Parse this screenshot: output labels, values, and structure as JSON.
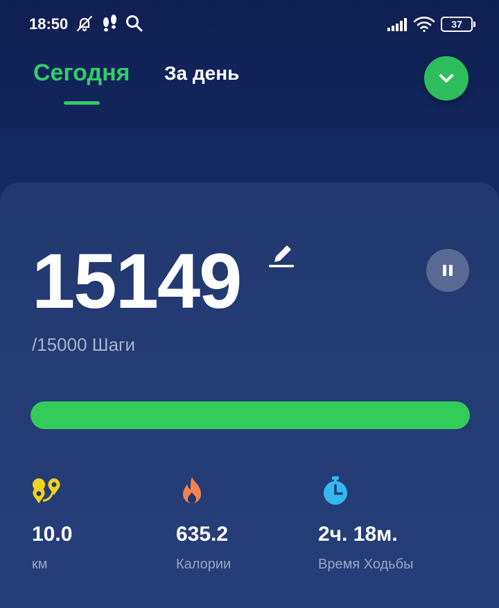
{
  "status_bar": {
    "time": "18:50",
    "icons": [
      "bell-off-icon",
      "footsteps-icon",
      "search-icon",
      "signal-icon",
      "wifi-icon"
    ],
    "battery": "37"
  },
  "tabs": [
    {
      "label": "Сегодня",
      "active": true
    },
    {
      "label": "За день",
      "active": false
    }
  ],
  "steps": {
    "value": "15149",
    "goal_text": "/15000 Шаги",
    "progress": 1.0
  },
  "stats": [
    {
      "icon": "route-pin-icon",
      "value": "10.0",
      "label": "км",
      "color": "#f2d21b"
    },
    {
      "icon": "flame-icon",
      "value": "635.2",
      "label": "Калории",
      "color": "#f5844a"
    },
    {
      "icon": "stopwatch-icon",
      "value": "2ч. 18м.",
      "label": "Время Ходьбы",
      "color": "#35b8f0"
    }
  ],
  "colors": {
    "accent": "#33cc66",
    "progress": "#33cc5a",
    "background": "#142a62"
  }
}
